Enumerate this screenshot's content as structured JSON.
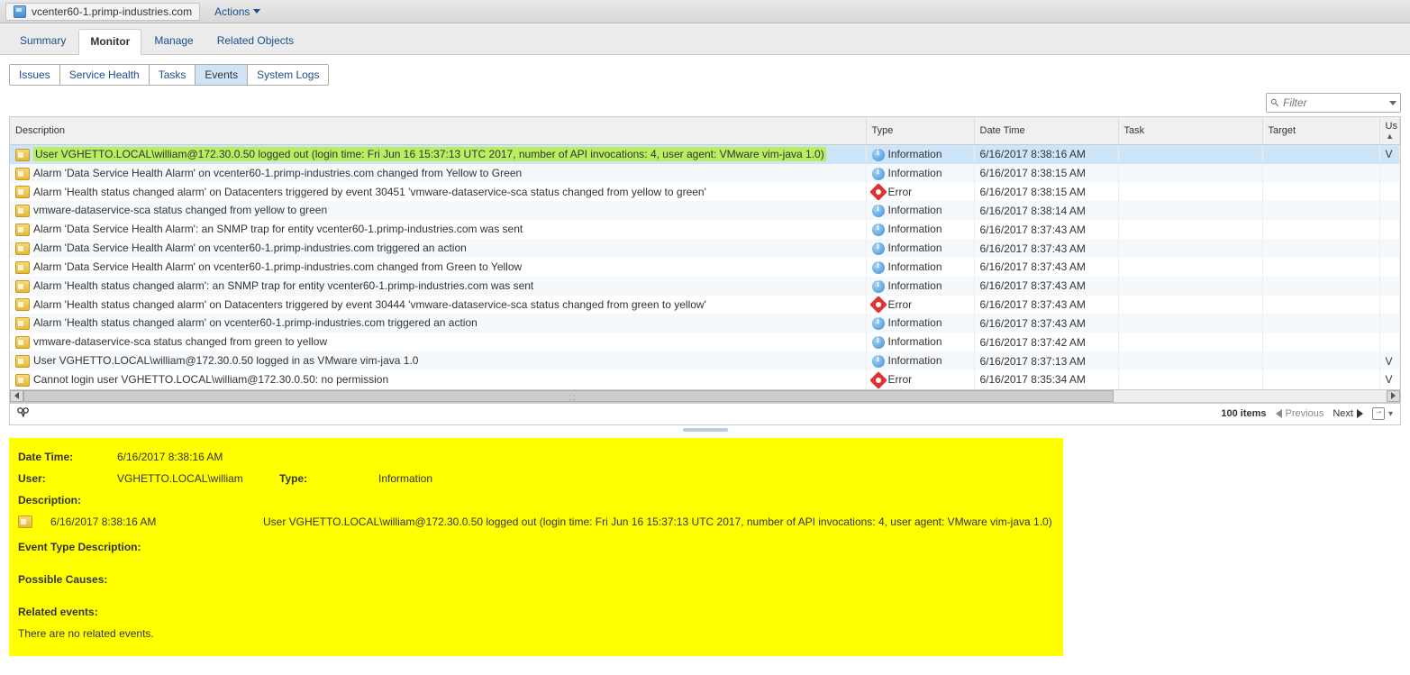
{
  "header": {
    "host": "vcenter60-1.primp-industries.com",
    "actions": "Actions"
  },
  "tabs": [
    "Summary",
    "Monitor",
    "Manage",
    "Related Objects"
  ],
  "active_tab": "Monitor",
  "subtabs": [
    "Issues",
    "Service Health",
    "Tasks",
    "Events",
    "System Logs"
  ],
  "active_subtab": "Events",
  "filter_placeholder": "Filter",
  "columns": {
    "description": "Description",
    "type": "Type",
    "datetime": "Date Time",
    "task": "Task",
    "target": "Target",
    "user": "Us"
  },
  "rows": [
    {
      "desc": "User VGHETTO.LOCAL\\william@172.30.0.50 logged out (login time: Fri Jun 16 15:37:13 UTC 2017, number of API invocations: 4, user agent: VMware vim-java 1.0)",
      "type": "Information",
      "tclass": "info",
      "dt": "6/16/2017 8:38:16 AM",
      "task": "",
      "target": "",
      "user": "V",
      "selected": true,
      "highlight": true
    },
    {
      "desc": "Alarm 'Data Service Health Alarm' on vcenter60-1.primp-industries.com changed from Yellow to Green",
      "type": "Information",
      "tclass": "info",
      "dt": "6/16/2017 8:38:15 AM",
      "task": "",
      "target": "",
      "user": ""
    },
    {
      "desc": "Alarm 'Health status changed alarm' on Datacenters triggered by event 30451 'vmware-dataservice-sca status changed from yellow to green'",
      "type": "Error",
      "tclass": "error",
      "dt": "6/16/2017 8:38:15 AM",
      "task": "",
      "target": "",
      "user": ""
    },
    {
      "desc": "vmware-dataservice-sca status changed from yellow to green",
      "type": "Information",
      "tclass": "info",
      "dt": "6/16/2017 8:38:14 AM",
      "task": "",
      "target": "",
      "user": ""
    },
    {
      "desc": "Alarm 'Data Service Health Alarm': an SNMP trap for entity vcenter60-1.primp-industries.com was sent",
      "type": "Information",
      "tclass": "info",
      "dt": "6/16/2017 8:37:43 AM",
      "task": "",
      "target": "",
      "user": ""
    },
    {
      "desc": "Alarm 'Data Service Health Alarm' on vcenter60-1.primp-industries.com triggered an action",
      "type": "Information",
      "tclass": "info",
      "dt": "6/16/2017 8:37:43 AM",
      "task": "",
      "target": "",
      "user": ""
    },
    {
      "desc": "Alarm 'Data Service Health Alarm' on vcenter60-1.primp-industries.com changed from Green to Yellow",
      "type": "Information",
      "tclass": "info",
      "dt": "6/16/2017 8:37:43 AM",
      "task": "",
      "target": "",
      "user": ""
    },
    {
      "desc": "Alarm 'Health status changed alarm': an SNMP trap for entity vcenter60-1.primp-industries.com was sent",
      "type": "Information",
      "tclass": "info",
      "dt": "6/16/2017 8:37:43 AM",
      "task": "",
      "target": "",
      "user": ""
    },
    {
      "desc": "Alarm 'Health status changed alarm' on Datacenters triggered by event 30444 'vmware-dataservice-sca status changed from green to yellow'",
      "type": "Error",
      "tclass": "error",
      "dt": "6/16/2017 8:37:43 AM",
      "task": "",
      "target": "",
      "user": ""
    },
    {
      "desc": "Alarm 'Health status changed alarm' on vcenter60-1.primp-industries.com triggered an action",
      "type": "Information",
      "tclass": "info",
      "dt": "6/16/2017 8:37:43 AM",
      "task": "",
      "target": "",
      "user": ""
    },
    {
      "desc": "vmware-dataservice-sca status changed from green to yellow",
      "type": "Information",
      "tclass": "info",
      "dt": "6/16/2017 8:37:42 AM",
      "task": "",
      "target": "",
      "user": ""
    },
    {
      "desc": "User VGHETTO.LOCAL\\william@172.30.0.50 logged in as VMware vim-java 1.0",
      "type": "Information",
      "tclass": "info",
      "dt": "6/16/2017 8:37:13 AM",
      "task": "",
      "target": "",
      "user": "V"
    },
    {
      "desc": "Cannot login user VGHETTO.LOCAL\\william@172.30.0.50: no permission",
      "type": "Error",
      "tclass": "error",
      "dt": "6/16/2017 8:35:34 AM",
      "task": "",
      "target": "",
      "user": "V"
    }
  ],
  "footer": {
    "count": "100 items",
    "prev": "Previous",
    "next": "Next"
  },
  "detail": {
    "labels": {
      "datetime": "Date Time:",
      "user": "User:",
      "type": "Type:",
      "description": "Description:",
      "event_type_desc": "Event Type Description:",
      "possible_causes": "Possible Causes:",
      "related_events": "Related events:"
    },
    "datetime": "6/16/2017 8:38:16 AM",
    "user": "VGHETTO.LOCAL\\william",
    "type": "Information",
    "desc_dt": "6/16/2017 8:38:16 AM",
    "desc_text": "User VGHETTO.LOCAL\\william@172.30.0.50 logged out (login time: Fri Jun 16 15:37:13 UTC 2017, number of API invocations: 4, user agent: VMware vim-java 1.0)",
    "no_related": "There are no related events."
  }
}
